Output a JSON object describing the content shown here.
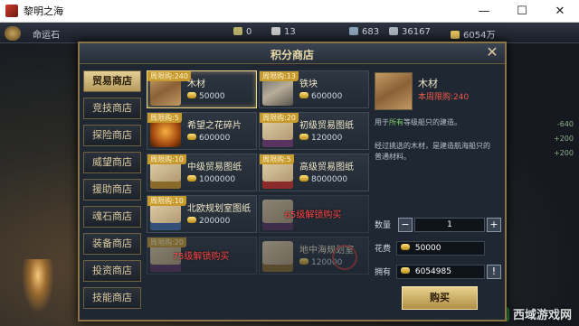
{
  "window": {
    "title": "黎明之海",
    "minimize": "—",
    "maximize": "☐",
    "close": "✕"
  },
  "hud": {
    "left_label": "命运石",
    "res1": "0",
    "res2": "13",
    "res3": "683",
    "res4": "36167",
    "res5": "6054万",
    "right_bg_lines": [
      "-640",
      "+200",
      "+200",
      "..."
    ]
  },
  "dialog": {
    "title": "积分商店",
    "close_icon": "close-icon"
  },
  "tabs": [
    "贸易商店",
    "竞技商店",
    "探险商店",
    "威望商店",
    "援助商店",
    "魂石商店",
    "装备商店",
    "投资商店",
    "技能商店"
  ],
  "active_tab": 0,
  "items": [
    {
      "badge": "周限购:240",
      "name": "木材",
      "price": "50000",
      "thumb": "wood",
      "state": "selected"
    },
    {
      "badge": "周限购:13",
      "name": "铁块",
      "price": "600000",
      "thumb": "iron",
      "state": "normal"
    },
    {
      "badge": "周限购:5",
      "name": "希望之花碎片",
      "price": "600000",
      "thumb": "flower",
      "state": "normal"
    },
    {
      "badge": "周限购:20",
      "name": "初级贸易图纸",
      "price": "120000",
      "thumb": "paper-purple",
      "state": "normal"
    },
    {
      "badge": "周限购:10",
      "name": "中级贸易图纸",
      "price": "1000000",
      "thumb": "paper-gold",
      "state": "normal"
    },
    {
      "badge": "周限购:5",
      "name": "高级贸易图纸",
      "price": "8000000",
      "thumb": "paper-red",
      "state": "normal"
    },
    {
      "badge": "周限购:10",
      "name": "北欧规划室图纸",
      "price": "200000",
      "thumb": "paper-blue",
      "state": "normal"
    },
    {
      "badge": "",
      "name": "",
      "price": "",
      "thumb": "paper-purple",
      "state": "locked",
      "lock_text": "65级解锁购买"
    },
    {
      "badge": "周限购:20",
      "name": "",
      "price": "",
      "thumb": "paper-purple",
      "state": "locked",
      "lock_text": "75级解锁购买"
    },
    {
      "badge": "",
      "name": "地中海规划室",
      "price": "120000",
      "thumb": "paper-gold",
      "state": "locked",
      "lock_text": ""
    }
  ],
  "detail": {
    "name": "木材",
    "limit": "本周限购:240",
    "desc1_pre": "用于",
    "desc1_hl": "所有",
    "desc1_post": "等级船只的建造。",
    "desc2": "经过挑选的木材，是建造航海船只的普通材料。",
    "qty_label": "数量",
    "qty_value": "1",
    "cost_label": "花费",
    "cost_value": "50000",
    "own_label": "拥有",
    "own_value": "6054985",
    "buy_label": "购买",
    "minus": "−",
    "plus": "+",
    "warn": "!"
  },
  "watermark": "西域游戏网"
}
